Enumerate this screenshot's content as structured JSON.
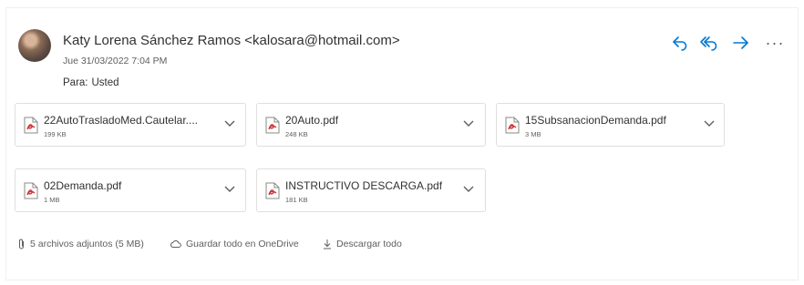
{
  "sender": {
    "display": "Katy Lorena Sánchez Ramos <kalosara@hotmail.com>",
    "date": "Jue 31/03/2022 7:04 PM",
    "to_label": "Para:",
    "to_value": "Usted"
  },
  "actions": {
    "reply_icon": "reply-icon",
    "reply_all_icon": "reply-all-icon",
    "forward_icon": "forward-icon",
    "more_label": "···",
    "accent_color": "#0078d4"
  },
  "attachments": [
    {
      "name": "22AutoTrasladoMed.Cautelar....",
      "size": "199 KB",
      "icon": "pdf-icon"
    },
    {
      "name": "20Auto.pdf",
      "size": "248 KB",
      "icon": "pdf-icon"
    },
    {
      "name": "15SubsanacionDemanda.pdf",
      "size": "3 MB",
      "icon": "pdf-icon"
    },
    {
      "name": "02Demanda.pdf",
      "size": "1 MB",
      "icon": "pdf-icon"
    },
    {
      "name": "INSTRUCTIVO DESCARGA.pdf",
      "size": "181 KB",
      "icon": "pdf-icon"
    }
  ],
  "footer": {
    "count_label": "5 archivos adjuntos (5 MB)",
    "save_onedrive_label": "Guardar todo en OneDrive",
    "download_all_label": "Descargar todo"
  },
  "colors": {
    "pdf_red": "#d13438",
    "text": "#323130",
    "muted": "#605e5c",
    "border": "#e1dfdd"
  }
}
